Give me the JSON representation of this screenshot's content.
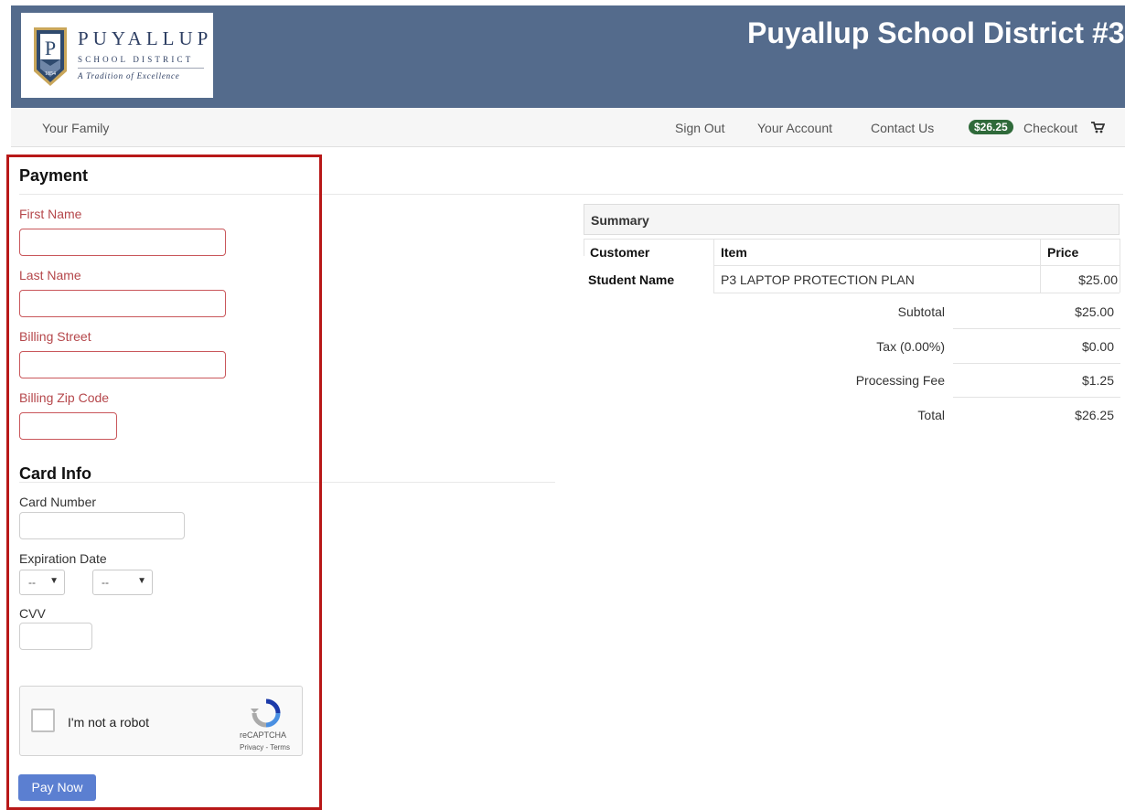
{
  "header": {
    "logo": {
      "letter": "P",
      "name": "PUYALLUP",
      "sub": "SCHOOL DISTRICT",
      "tagline": "A Tradition of Excellence",
      "year": "1854"
    },
    "site_title": "Puyallup School District #3"
  },
  "nav": {
    "family": "Your Family",
    "sign_out": "Sign Out",
    "account": "Your Account",
    "contact": "Contact Us",
    "cart_total": "$26.25",
    "checkout": "Checkout",
    "cart_icon": "cart-icon"
  },
  "payment": {
    "title": "Payment",
    "first_name": {
      "label": "First Name",
      "value": ""
    },
    "last_name": {
      "label": "Last Name",
      "value": ""
    },
    "street": {
      "label": "Billing Street",
      "value": ""
    },
    "zip": {
      "label": "Billing Zip Code",
      "value": ""
    }
  },
  "card": {
    "title": "Card Info",
    "number": {
      "label": "Card Number",
      "value": ""
    },
    "expiration": {
      "label": "Expiration Date",
      "month": "--",
      "year": "--"
    },
    "cvv": {
      "label": "CVV",
      "value": ""
    }
  },
  "captcha": {
    "label": "I'm not a robot",
    "brand": "reCAPTCHA",
    "links": "Privacy - Terms"
  },
  "pay_button": "Pay Now",
  "summary": {
    "title": "Summary",
    "columns": [
      "Customer",
      "Item",
      "Price"
    ],
    "rows": [
      {
        "customer": "Student Name",
        "item": "P3 LAPTOP PROTECTION PLAN",
        "price": "$25.00"
      }
    ],
    "subtotal": {
      "label": "Subtotal",
      "value": "$25.00"
    },
    "tax": {
      "label": "Tax (0.00%)",
      "value": "$0.00"
    },
    "fee": {
      "label": "Processing Fee",
      "value": "$1.25"
    },
    "total": {
      "label": "Total",
      "value": "$26.25"
    }
  },
  "colors": {
    "header_bg": "#546b8c",
    "highlight_border": "#b81818",
    "error_text": "#b5474b",
    "pay_button": "#5b7fd1",
    "cart_badge": "#2f6a3a"
  }
}
